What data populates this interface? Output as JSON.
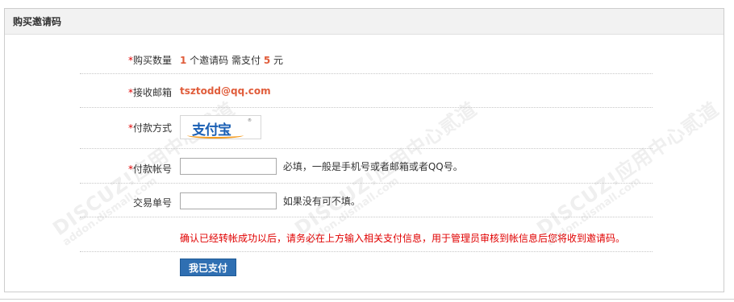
{
  "panel": {
    "title": "购买邀请码"
  },
  "watermarks": {
    "brand": "DISCUZ!应用中心",
    "url": "addon.dismall.com",
    "suffix": "贰道"
  },
  "form": {
    "required_mark": "*",
    "quantity": {
      "label": "购买数量",
      "count": "1",
      "unit_text": " 个邀请码 需支付 ",
      "price": "5",
      "currency": " 元"
    },
    "email": {
      "label": "接收邮箱",
      "value": "tsztodd@qq.com"
    },
    "payment_method": {
      "label": "付款方式",
      "alipay_logo_text": "支付宝",
      "alipay_tm": "®"
    },
    "account": {
      "label": "付款帐号",
      "value": "",
      "hint": "必填，一般是手机号或者邮箱或者QQ号。"
    },
    "transaction": {
      "label": "交易单号",
      "value": "",
      "hint": "如果没有可不填。"
    },
    "notice": "确认已经转帐成功以后，请务必在上方输入相关支付信息，用于管理员审核到帐信息后您将收到邀请码。",
    "submit_label": "我已支付"
  }
}
